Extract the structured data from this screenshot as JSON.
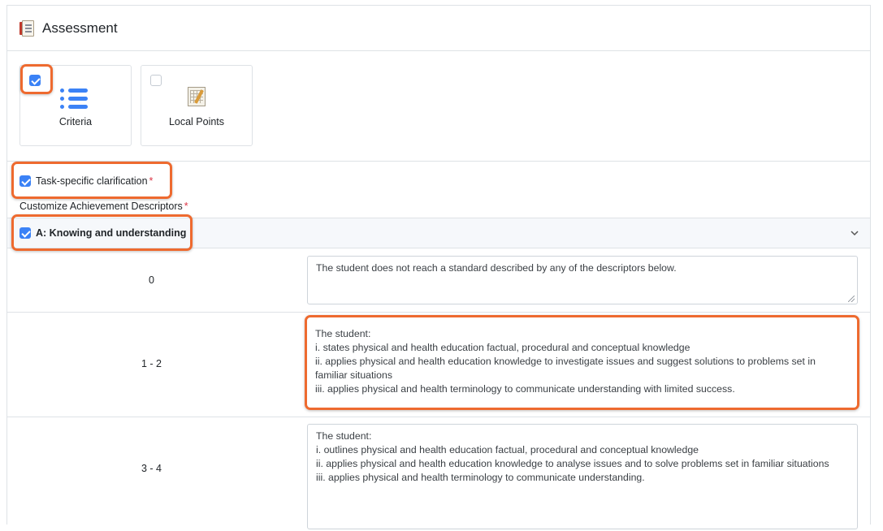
{
  "panel": {
    "title": "Assessment",
    "title_icon": "assessment-document-icon"
  },
  "assessment_types": [
    {
      "label": "Criteria",
      "checked": true,
      "icon": "list-icon"
    },
    {
      "label": "Local Points",
      "checked": false,
      "icon": "points-pad-icon"
    }
  ],
  "task_specific": {
    "label": "Task-specific clarification",
    "required_mark": "*",
    "checked": true
  },
  "customize": {
    "label": "Customize Achievement Descriptors",
    "required_mark": "*"
  },
  "criterion": {
    "label": "A: Knowing and understanding",
    "checked": true,
    "expand_icon": "chevron-down-icon"
  },
  "levels": [
    {
      "range": "0",
      "descriptor": "The student does not reach a standard described by any of the descriptors below."
    },
    {
      "range": "1 - 2",
      "descriptor": "The student:\ni. states physical and health education factual, procedural and conceptual knowledge\nii. applies physical and health education knowledge to investigate issues and suggest solutions to problems set in familiar situations\niii. applies physical and health terminology to communicate understanding with limited success."
    },
    {
      "range": "3 - 4",
      "descriptor": "The student:\ni. outlines physical and health education factual, procedural and conceptual knowledge\nii. applies physical and health education knowledge to analyse issues and to solve problems set in familiar situations\niii. applies physical and health terminology to communicate understanding."
    }
  ],
  "colors": {
    "accent": "#3b82f6",
    "highlight": "#ee6a2f",
    "required": "#dc3545"
  }
}
